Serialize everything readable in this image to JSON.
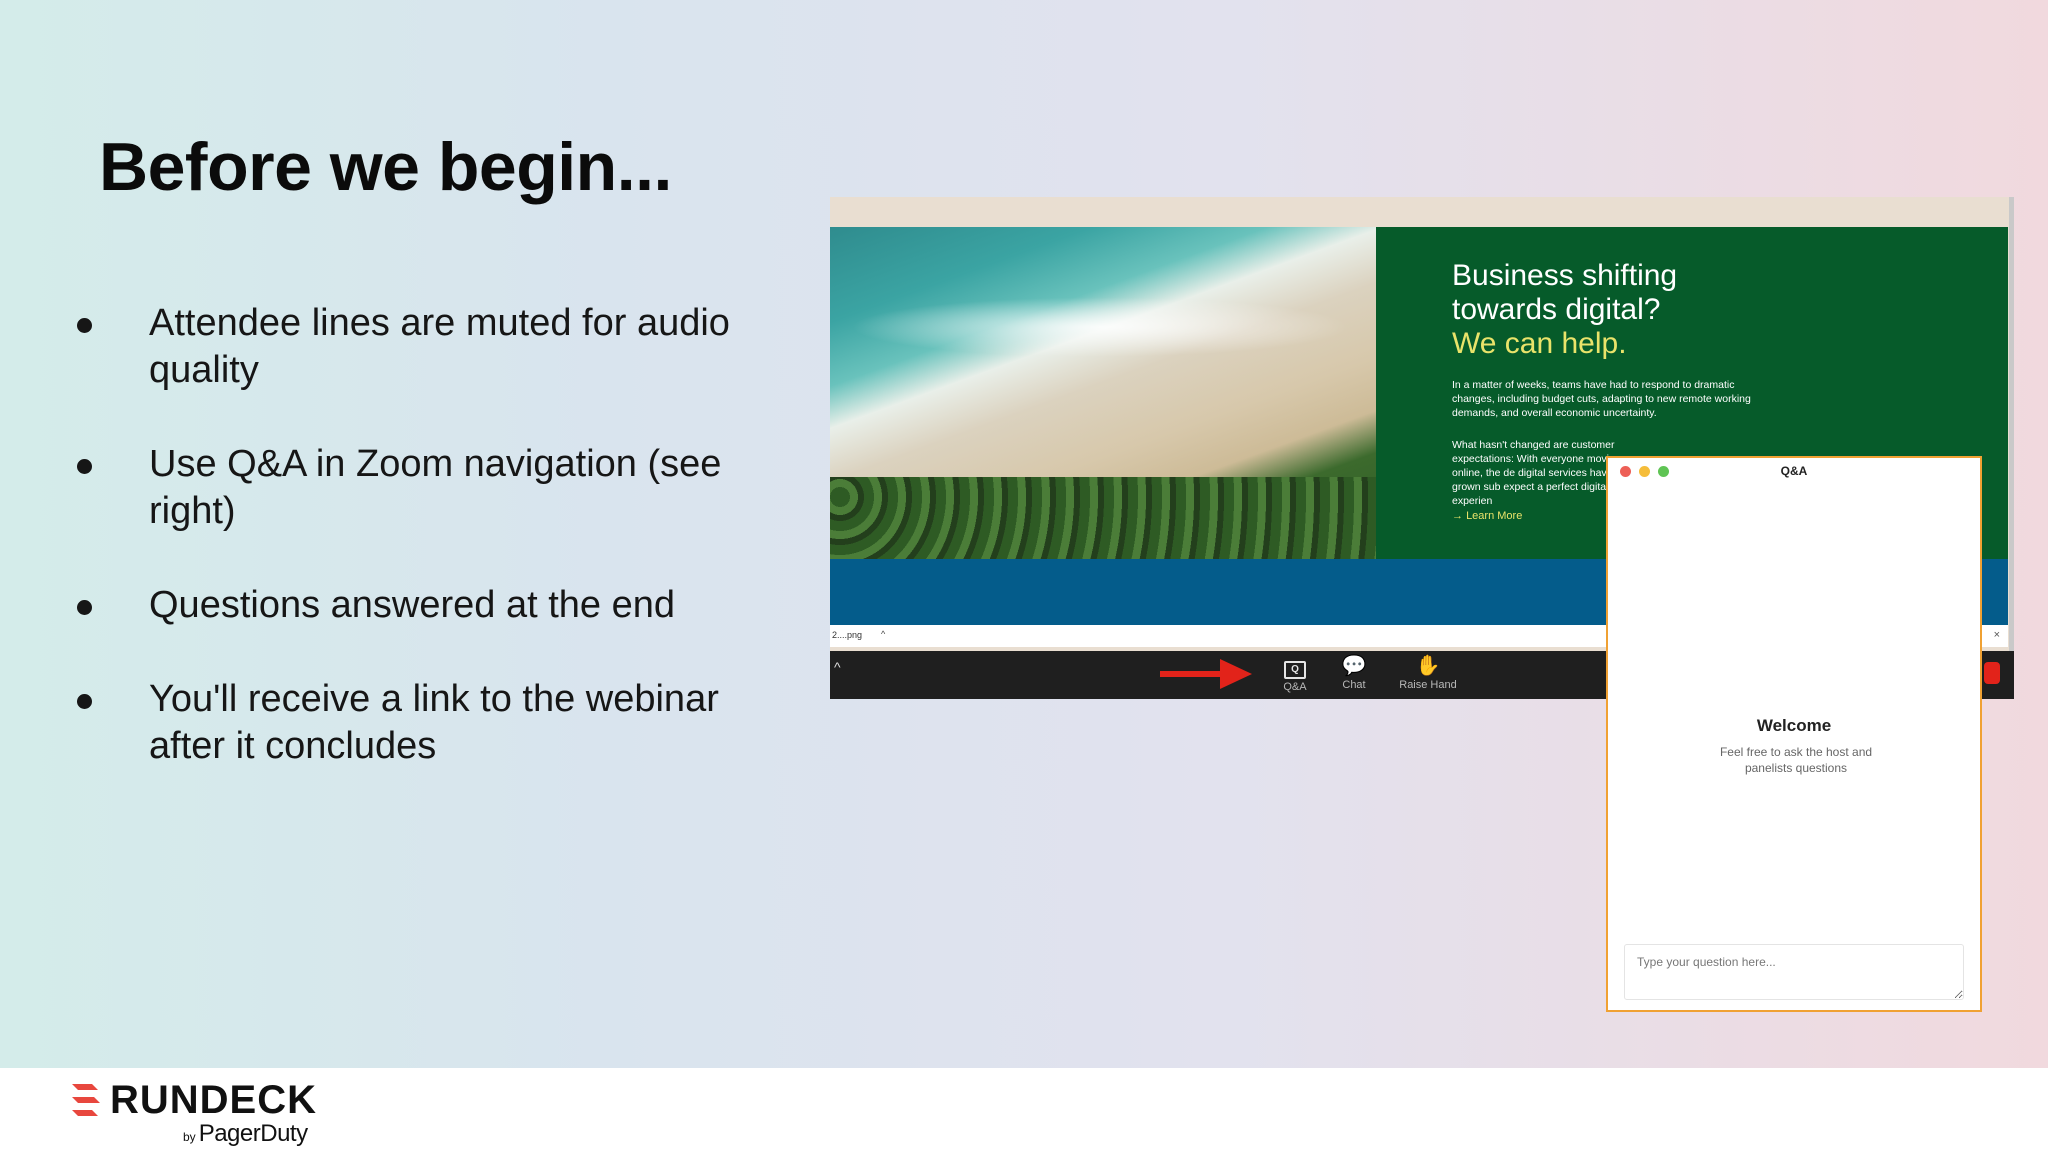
{
  "slide": {
    "title": "Before we begin...",
    "bullets": [
      "Attendee lines are muted for audio quality",
      "Use Q&A in Zoom navigation (see right)",
      "Questions answered at the end",
      "You'll receive a link to the webinar after it concludes"
    ]
  },
  "screenshot": {
    "banner": {
      "headline_line1": "Business shifting",
      "headline_line2": "towards digital?",
      "headline_highlight": "We can help.",
      "paragraph1": "In a matter of weeks, teams have had to respond to dramatic changes, including budget cuts, adapting to new remote working demands, and overall economic uncertainty.",
      "paragraph2": "What hasn't changed are customer expectations: With everyone moving online, the de digital services have grown sub expect a perfect digital experien",
      "learn_more": "Learn More"
    },
    "download_bar": {
      "file_name": "2....png",
      "chevron": "^",
      "close": "×"
    },
    "toolbar": {
      "expand": "^",
      "qa_label": "Q&A",
      "qa_glyph": "Q",
      "chat_label": "Chat",
      "chat_icon": "💬",
      "raise_hand_label": "Raise Hand",
      "raise_hand_icon": "✋"
    }
  },
  "qa_window": {
    "title": "Q&A",
    "welcome": "Welcome",
    "description": "Feel free to ask the host and panelists questions",
    "input_placeholder": "Type your question here..."
  },
  "footer": {
    "logo_word": "RUNDECK",
    "logo_by": "by",
    "logo_company": "PagerDuty"
  },
  "colors": {
    "accent_green": "#065b2a",
    "highlight_yellow": "#e9e36a",
    "arrow_red": "#e2231a",
    "qa_border": "#f0a133"
  }
}
